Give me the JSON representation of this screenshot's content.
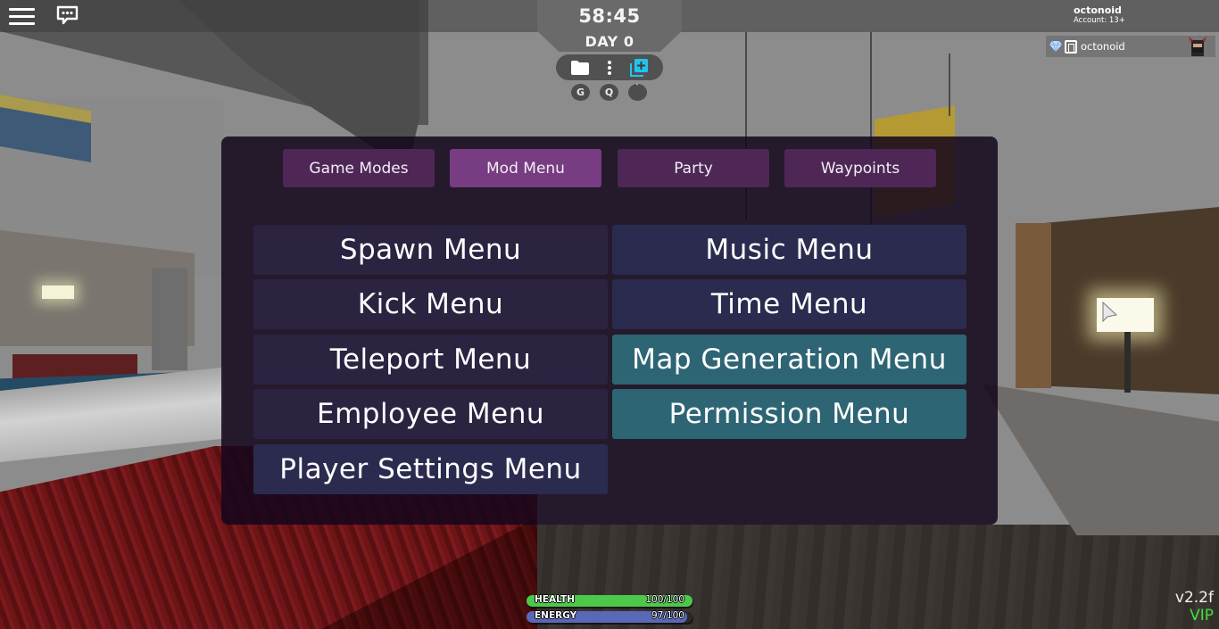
{
  "hud": {
    "timer": "58:45",
    "day": "DAY 0",
    "toolbar": [
      {
        "icon": "folder-icon"
      },
      {
        "icon": "more-vertical-icon"
      },
      {
        "icon": "add-layers-icon",
        "color": "#22c3f0"
      }
    ],
    "hotkeys": [
      "G",
      "Q",
      "`"
    ]
  },
  "account": {
    "username": "octonoid",
    "account_type": "Account: 13+"
  },
  "player_list": [
    {
      "name": "octonoid",
      "badges": [
        "gem-icon",
        "premium-icon"
      ]
    }
  ],
  "panel": {
    "tabs": [
      {
        "label": "Game Modes",
        "active": false
      },
      {
        "label": "Mod Menu",
        "active": true
      },
      {
        "label": "Party",
        "active": false
      },
      {
        "label": "Waypoints",
        "active": false
      }
    ],
    "menu_buttons": [
      {
        "label": "Spawn Menu",
        "color": "#2b2340"
      },
      {
        "label": "Music Menu",
        "color": "#2a2b4e"
      },
      {
        "label": "Kick Menu",
        "color": "#2b2340"
      },
      {
        "label": "Time Menu",
        "color": "#2a2b4e"
      },
      {
        "label": "Teleport Menu",
        "color": "#2b2340"
      },
      {
        "label": "Map Generation Menu",
        "color": "#2d6574"
      },
      {
        "label": "Employee Menu",
        "color": "#2b2340"
      },
      {
        "label": "Permission Menu",
        "color": "#2d6574"
      },
      {
        "label": "Player Settings Menu",
        "color": "#2a2b4e"
      }
    ]
  },
  "stats": {
    "health": {
      "label": "HEALTH",
      "value": "100/100",
      "fraction": 1.0,
      "color": "#4cc84a"
    },
    "energy": {
      "label": "ENERGY",
      "value": "97/100",
      "fraction": 0.97,
      "color": "#5a68b8"
    }
  },
  "footer": {
    "version": "v2.2f",
    "vip_label": "VIP",
    "vip_color": "#3fe13f"
  }
}
